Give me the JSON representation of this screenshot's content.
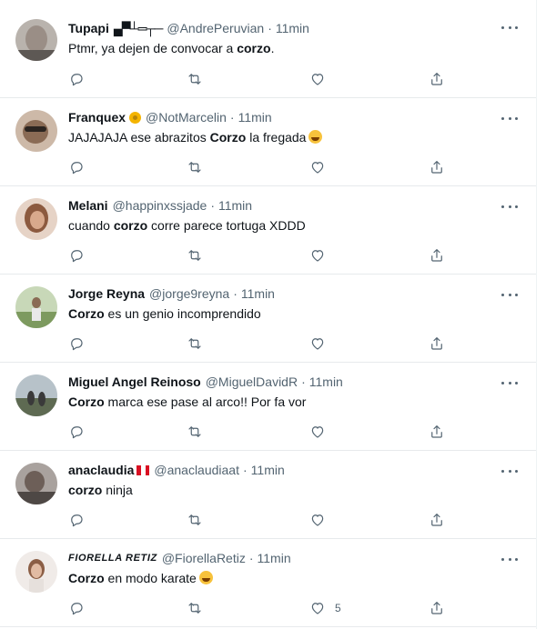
{
  "tweets": [
    {
      "name": "Tupapi",
      "glyphs": "▄▀┴═┬─",
      "handle": "@AndrePeruvian",
      "time": "11min",
      "pre": "Ptmr, ya dejen de convocar a ",
      "bold": "corzo",
      "post": ".",
      "bold_first": false,
      "avatar": "#9a9a9a",
      "like_count": ""
    },
    {
      "name": "Franquex",
      "handle": "@NotMarcelin",
      "time": "11min",
      "pre": "JAJAJAJA ese abrazitos ",
      "bold": "Corzo",
      "post": " la fregada",
      "bold_first": false,
      "avatar": "#7e6a5a",
      "like_count": ""
    },
    {
      "name": "Melani",
      "handle": "@happinxssjade",
      "time": "11min",
      "pre": "cuando ",
      "bold": "corzo",
      "post": " corre parece tortuga XDDD",
      "bold_first": false,
      "avatar": "#c9a48d",
      "like_count": ""
    },
    {
      "name": "Jorge Reyna",
      "handle": "@jorge9reyna",
      "time": "11min",
      "pre": "",
      "bold": "Corzo",
      "post": " es un genio incomprendido",
      "bold_first": true,
      "avatar": "#8da27a",
      "like_count": ""
    },
    {
      "name": "Miguel Angel Reinoso",
      "handle": "@MiguelDavidR",
      "time": "11min",
      "pre": "",
      "bold": "Corzo",
      "post": " marca ese pase al arco!! Por fa vor",
      "bold_first": true,
      "avatar": "#6b7566",
      "like_count": ""
    },
    {
      "name": "anaclaudia",
      "handle": "@anaclaudiaat",
      "time": "11min",
      "pre": "",
      "bold": "corzo",
      "post": " ninja",
      "bold_first": true,
      "avatar": "#7d7370",
      "like_count": ""
    },
    {
      "name": "FIORELLA RETIZ",
      "handle": "@FiorellaRetiz",
      "time": "11min",
      "pre": "",
      "bold": "Corzo",
      "post": " en modo karate",
      "bold_first": true,
      "avatar": "#d9c6bd",
      "like_count": "5"
    }
  ],
  "icons": {
    "reply": "reply-icon",
    "retweet": "retweet-icon",
    "like": "heart-icon",
    "share": "share-icon",
    "more": "more-icon"
  },
  "colors": {
    "text": "#0f1419",
    "secondary": "#536471",
    "divider": "#e7eaec",
    "peru_red": "#d91023"
  }
}
